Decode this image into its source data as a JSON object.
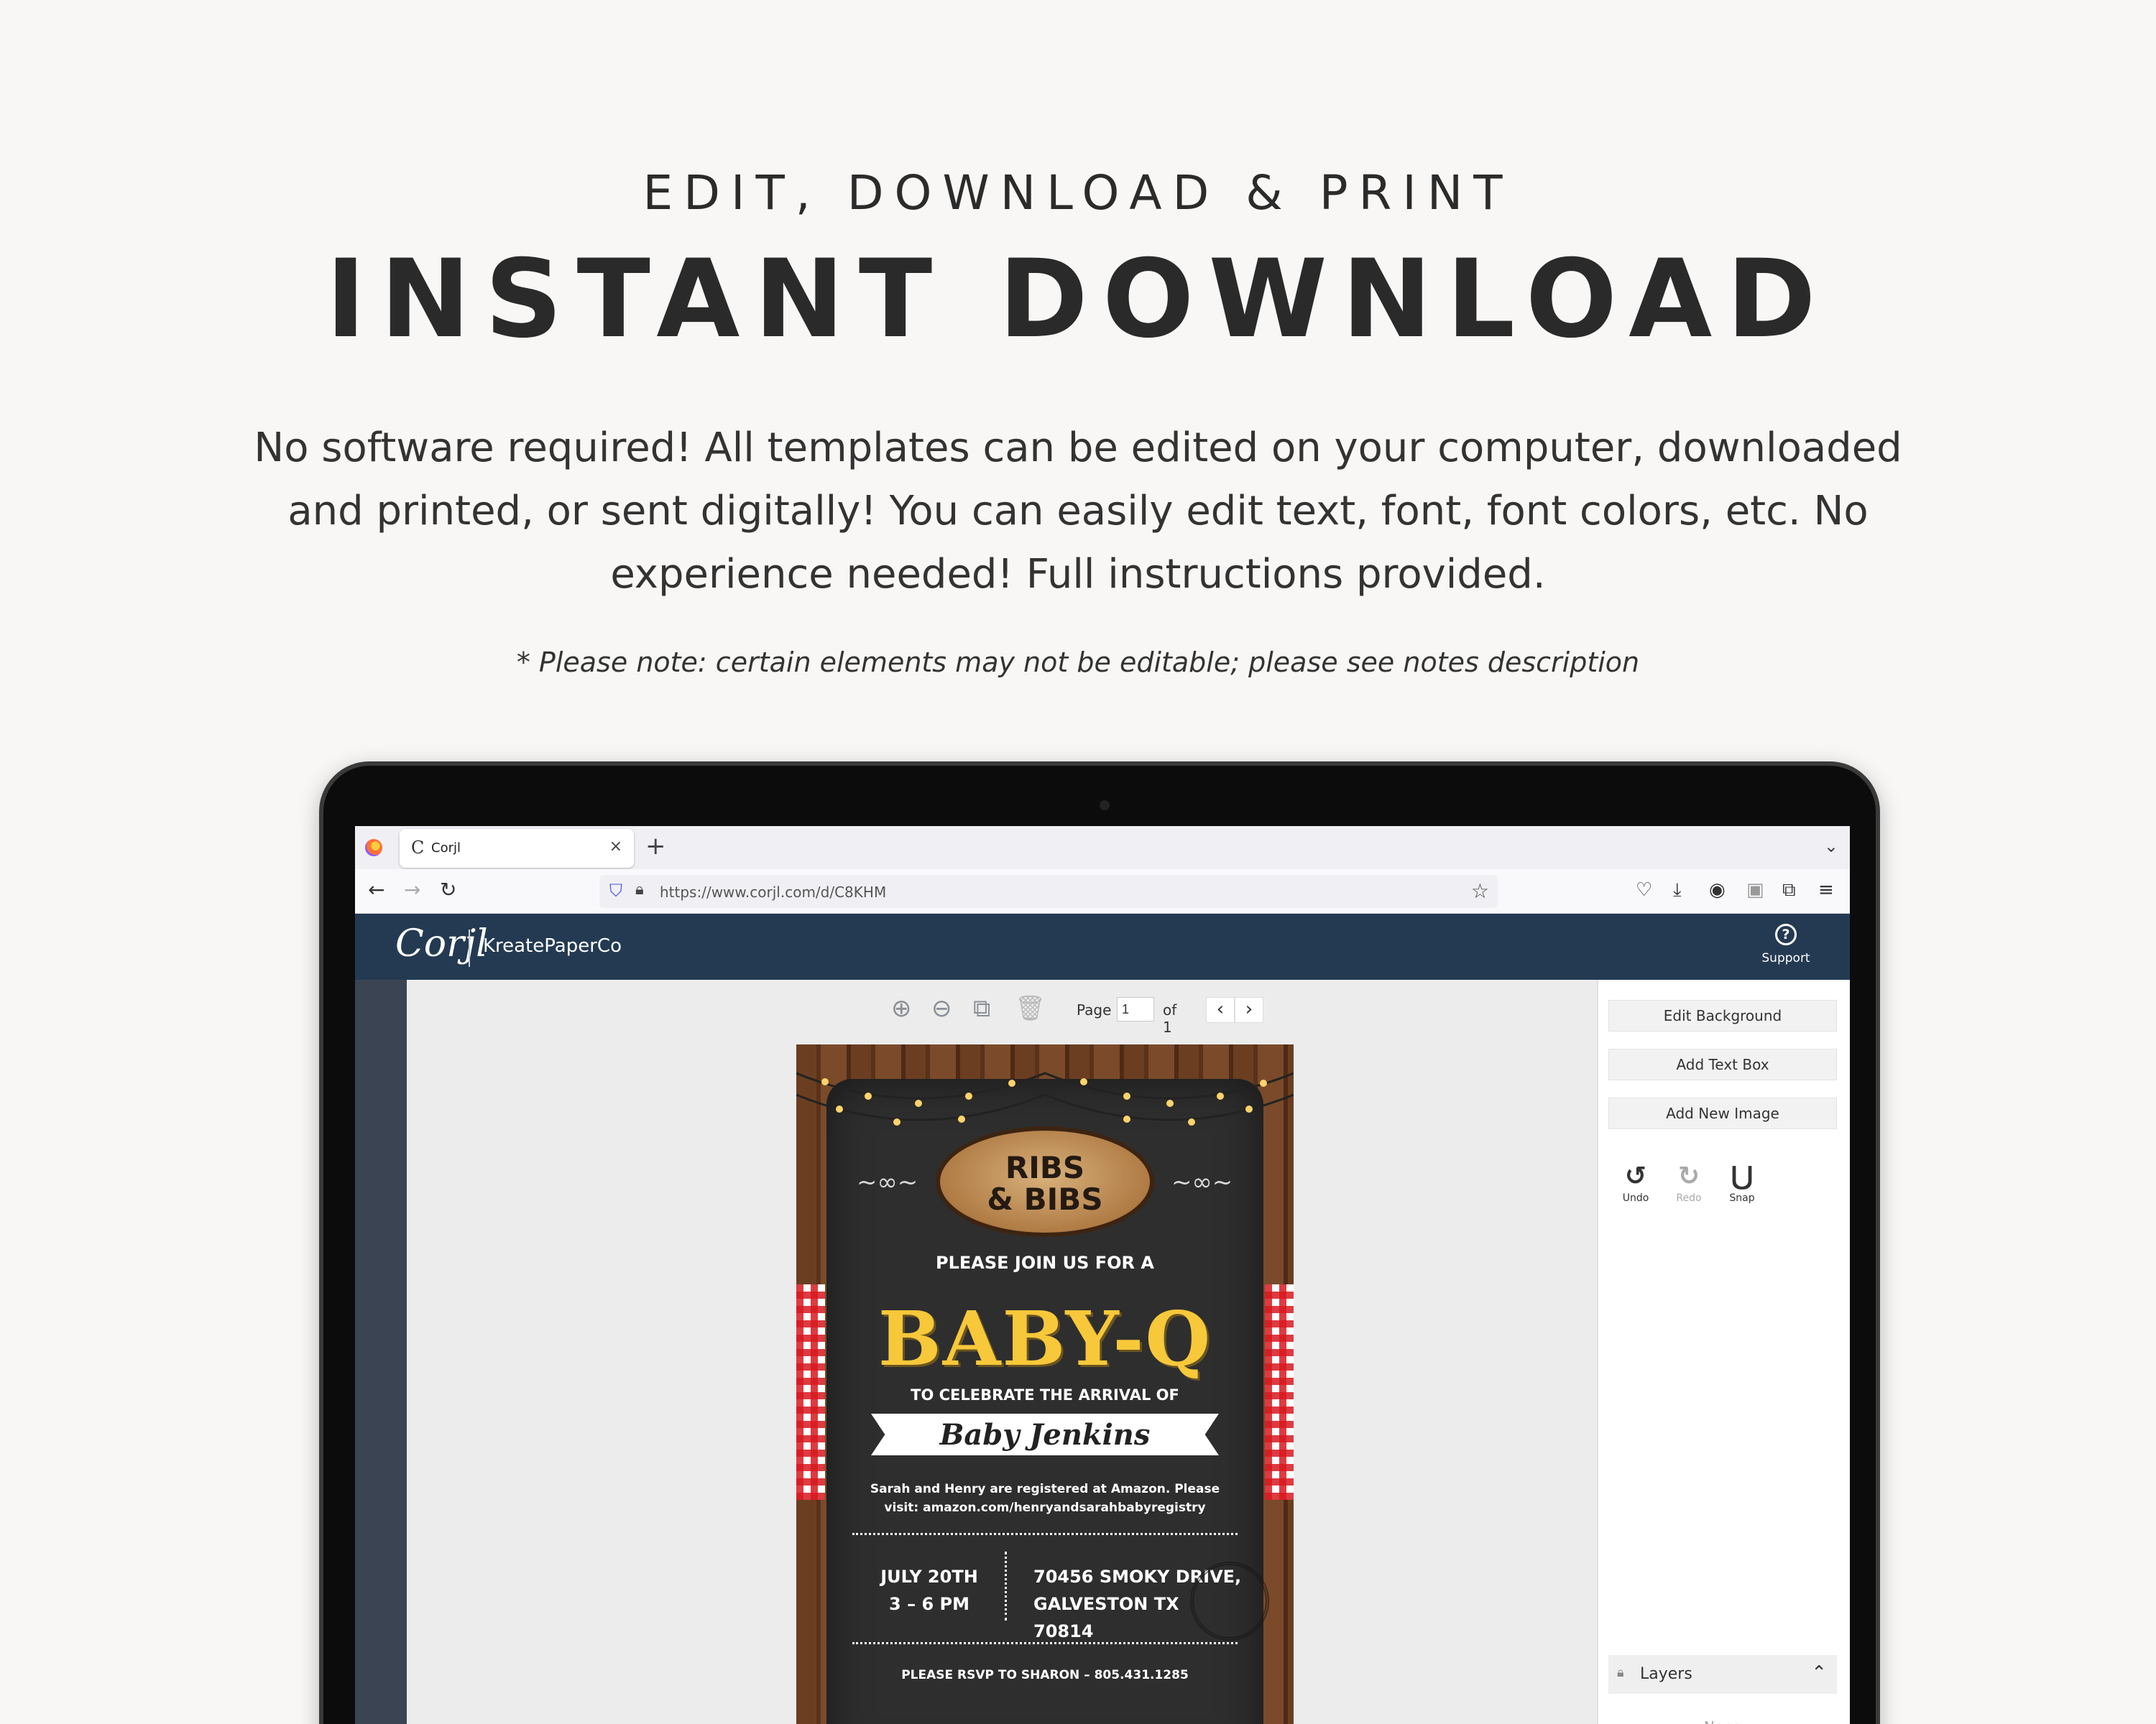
{
  "promo": {
    "subtitle": "EDIT, DOWNLOAD & PRINT",
    "title": "INSTANT DOWNLOAD",
    "description": "No software required! All templates can be edited on your computer, downloaded and printed, or sent digitally! You can easily edit text, font, font colors, etc. No experience needed! Full instructions provided.",
    "note": "* Please note: certain elements may not be editable; please see notes description"
  },
  "browser": {
    "tab_icon": "corjl-favicon",
    "tab_title": "Corjl",
    "tab_close": "×",
    "new_tab": "+",
    "tab_list": "⌄",
    "url": "https://www.corjl.com/d/C8KHM",
    "nav": {
      "back": "←",
      "forward": "→",
      "reload": "↻"
    },
    "toolbar_icons": [
      "pocket-icon",
      "download-icon",
      "password-icon",
      "extension-icon",
      "puzzle-icon",
      "menu-icon"
    ]
  },
  "app": {
    "logo": "Corjl",
    "shop_name": "KreatePaperCo",
    "support_icon": "?",
    "support_label": "Support"
  },
  "editor": {
    "page_label": "Page",
    "page_value": "1",
    "of_label": "of 1",
    "prev": "‹",
    "next": "›",
    "zoom_in_icon": "zoom-in-icon",
    "zoom_out_icon": "zoom-out-icon",
    "copy_icon": "copy-icon",
    "trash_icon": "trash-icon"
  },
  "invitation": {
    "sign": "RIBS\n& BIBS",
    "intro": "PLEASE JOIN US FOR A",
    "headline": "BABY-Q",
    "celebrate": "TO CELEBRATE THE ARRIVAL OF",
    "baby_name": "Baby Jenkins",
    "registry": "Sarah and Henry are registered at Amazon. Please visit: amazon.com/henryandsarahbabyregistry",
    "date": "JULY 20TH",
    "time": "3 – 6 PM",
    "address1": "70456 SMOKY DRIVE,",
    "address2": "GALVESTON TX 70814",
    "rsvp": "PLEASE RSVP TO SHARON – 805.431.1285"
  },
  "panel": {
    "edit_background": "Edit Background",
    "add_text_box": "Add Text Box",
    "add_new_image": "Add New Image",
    "undo": "Undo",
    "redo": "Redo",
    "snap": "Snap",
    "layers": "Layers",
    "layers_empty": "None"
  }
}
